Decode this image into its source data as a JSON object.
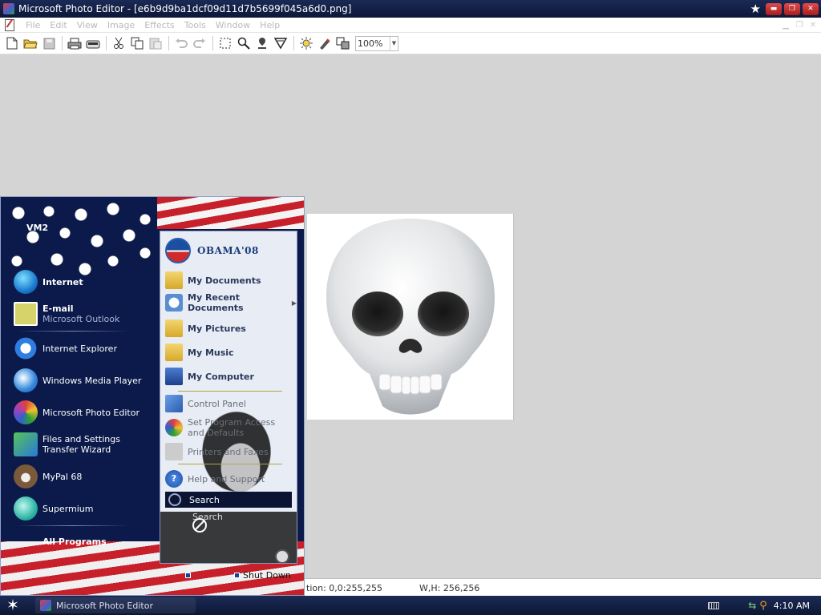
{
  "window": {
    "title": "Microsoft Photo Editor - [e6b9d9ba1dcf09d11d7b5699f045a6d0.png]"
  },
  "menubar": {
    "items": [
      "File",
      "Edit",
      "View",
      "Image",
      "Effects",
      "Tools",
      "Window",
      "Help"
    ]
  },
  "toolbar": {
    "icons": [
      "new-icon",
      "open-icon",
      "save-icon",
      "print-icon",
      "scan-icon",
      "cut-icon",
      "copy-icon",
      "paste-icon",
      "undo-icon",
      "redo-icon",
      "select-icon",
      "zoom-icon",
      "smudge-icon",
      "sharpen-icon",
      "balance-icon",
      "eraser-icon",
      "transparent-icon"
    ],
    "zoom_value": "100%"
  },
  "status": {
    "position": "tion: 0,0:255,255",
    "size": "W,H: 256,256"
  },
  "taskbar": {
    "task_label": "Microsoft Photo Editor",
    "clock": "4:10 AM"
  },
  "start_menu": {
    "user": "VM2",
    "pinned": [
      {
        "label": "Internet",
        "sub": "",
        "icon": "globe-icon"
      },
      {
        "label": "E-mail",
        "sub": "Microsoft Outlook",
        "icon": "email-icon"
      }
    ],
    "recent": [
      {
        "label": "Internet Explorer",
        "icon": "ie-icon"
      },
      {
        "label": "Windows Media Player",
        "icon": "media-player-icon"
      },
      {
        "label": "Microsoft Photo Editor",
        "icon": "photo-editor-icon"
      },
      {
        "label": "Files and Settings Transfer Wizard",
        "icon": "transfer-wizard-icon"
      },
      {
        "label": "MyPal 68",
        "icon": "mypal-icon"
      },
      {
        "label": "Supermium",
        "icon": "supermium-icon"
      }
    ],
    "all_programs": "All Programs",
    "logo_text": "OBAMA'08",
    "places": [
      {
        "label": "My Documents",
        "icon": "documents-icon"
      },
      {
        "label": "My Recent Documents",
        "icon": "recent-documents-icon"
      },
      {
        "label": "My Pictures",
        "icon": "pictures-icon"
      },
      {
        "label": "My Music",
        "icon": "music-icon"
      },
      {
        "label": "My Computer",
        "icon": "computer-icon"
      }
    ],
    "system": [
      {
        "label": "Control Panel",
        "icon": "control-panel-icon"
      },
      {
        "label": "Set Program Access and Defaults",
        "icon": "program-access-icon"
      },
      {
        "label": "Printers and Faxes",
        "icon": "printer-icon"
      },
      {
        "label": "Help and Support",
        "icon": "help-icon"
      }
    ],
    "search_label": "Search",
    "search_ghost": "Search",
    "shutdown_label": "Shut Down"
  },
  "colors": {
    "title_bar": "#0c1738",
    "start_menu_bg": "#0b1a4a",
    "flag_red": "#c8202a",
    "workspace": "#d4d4d4"
  }
}
